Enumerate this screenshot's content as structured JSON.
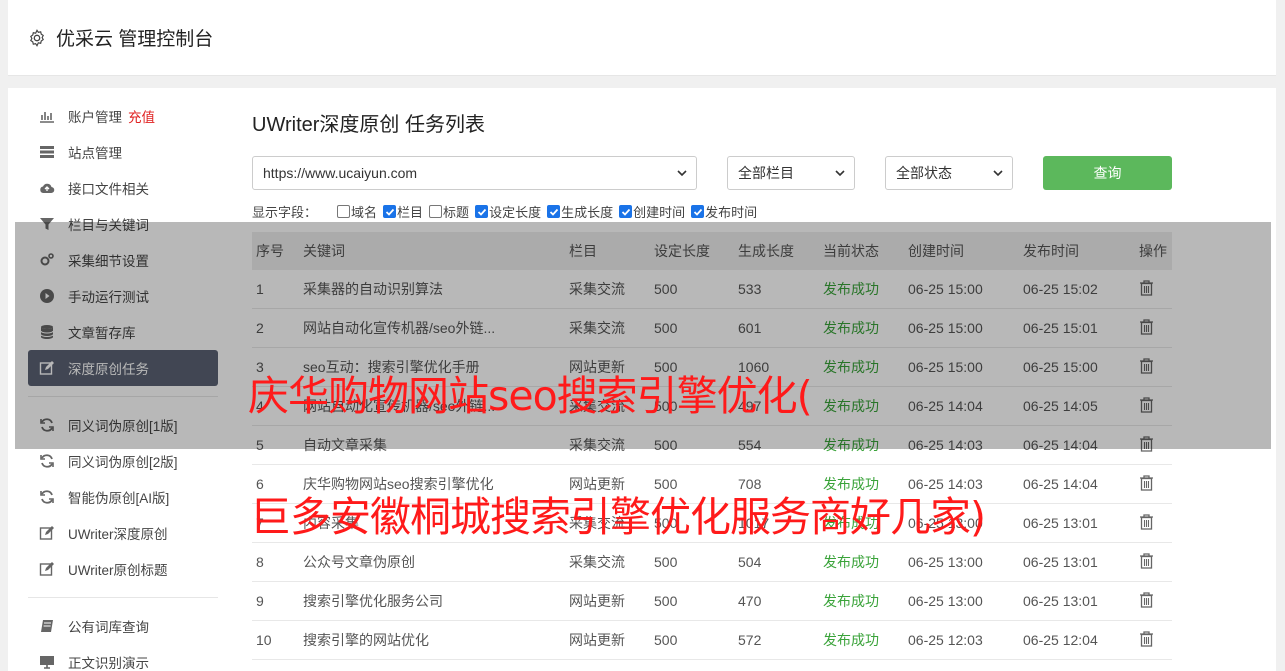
{
  "app": {
    "title": "优采云 管理控制台"
  },
  "sidebar": {
    "items": [
      {
        "label": "账户管理",
        "badge": "充值",
        "icon": "bar-chart-icon"
      },
      {
        "label": "站点管理",
        "icon": "server-icon"
      },
      {
        "label": "接口文件相关",
        "icon": "cloud-upload-icon"
      },
      {
        "label": "栏目与关键词",
        "icon": "filter-icon"
      },
      {
        "label": "采集细节设置",
        "icon": "cogs-icon"
      },
      {
        "label": "手动运行测试",
        "icon": "play-circle-icon"
      },
      {
        "label": "文章暂存库",
        "icon": "database-icon"
      },
      {
        "label": "深度原创任务",
        "icon": "edit-icon",
        "active": true
      }
    ],
    "items2": [
      {
        "label": "同义词伪原创[1版]",
        "icon": "refresh-icon"
      },
      {
        "label": "同义词伪原创[2版]",
        "icon": "refresh-icon"
      },
      {
        "label": "智能伪原创[AI版]",
        "icon": "refresh-icon"
      },
      {
        "label": "UWriter深度原创",
        "icon": "edit-icon"
      },
      {
        "label": "UWriter原创标题",
        "icon": "edit-icon"
      }
    ],
    "items3": [
      {
        "label": "公有词库查询",
        "icon": "book-icon"
      },
      {
        "label": "正文识别演示",
        "icon": "monitor-icon"
      }
    ]
  },
  "main": {
    "title": "UWriter深度原创 任务列表",
    "site_select": "https://www.ucaiyun.com",
    "column_select": "全部栏目",
    "status_select": "全部状态",
    "query_button": "查询",
    "fields_label": "显示字段：",
    "fields": [
      {
        "label": "域名",
        "checked": false
      },
      {
        "label": "栏目",
        "checked": true
      },
      {
        "label": "标题",
        "checked": false
      },
      {
        "label": "设定长度",
        "checked": true
      },
      {
        "label": "生成长度",
        "checked": true
      },
      {
        "label": "创建时间",
        "checked": true
      },
      {
        "label": "发布时间",
        "checked": true
      }
    ]
  },
  "table": {
    "headers": [
      "序号",
      "关键词",
      "栏目",
      "设定长度",
      "生成长度",
      "当前状态",
      "创建时间",
      "发布时间",
      "操作"
    ],
    "rows": [
      [
        "1",
        "采集器的自动识别算法",
        "采集交流",
        "500",
        "533",
        "发布成功",
        "06-25 15:00",
        "06-25 15:02"
      ],
      [
        "2",
        "网站自动化宣传机器/seo外链...",
        "采集交流",
        "500",
        "601",
        "发布成功",
        "06-25 15:00",
        "06-25 15:01"
      ],
      [
        "3",
        "seo互动：搜索引擎优化手册",
        "网站更新",
        "500",
        "1060",
        "发布成功",
        "06-25 15:00",
        "06-25 15:00"
      ],
      [
        "4",
        "网站自动化宣传机器/seo外链...",
        "采集交流",
        "500",
        "497",
        "发布成功",
        "06-25 14:04",
        "06-25 14:05"
      ],
      [
        "5",
        "自动文章采集",
        "采集交流",
        "500",
        "554",
        "发布成功",
        "06-25 14:03",
        "06-25 14:04"
      ],
      [
        "6",
        "庆华购物网站seo搜索引擎优化",
        "网站更新",
        "500",
        "708",
        "发布成功",
        "06-25 14:03",
        "06-25 14:04"
      ],
      [
        "7",
        "内容采集",
        "采集交流",
        "500",
        "1017",
        "发布成功",
        "06-25 13:00",
        "06-25 13:01"
      ],
      [
        "8",
        "公众号文章伪原创",
        "采集交流",
        "500",
        "504",
        "发布成功",
        "06-25 13:00",
        "06-25 13:01"
      ],
      [
        "9",
        "搜索引擎优化服务公司",
        "网站更新",
        "500",
        "470",
        "发布成功",
        "06-25 13:00",
        "06-25 13:01"
      ],
      [
        "10",
        "搜索引擎的网站优化",
        "网站更新",
        "500",
        "572",
        "发布成功",
        "06-25 12:03",
        "06-25 12:04"
      ]
    ]
  },
  "overlay": {
    "line1": "庆华购物网站seo搜索引擎优化(",
    "line2": "巨多安徽桐城搜索引擎优化服务商好几家)"
  }
}
